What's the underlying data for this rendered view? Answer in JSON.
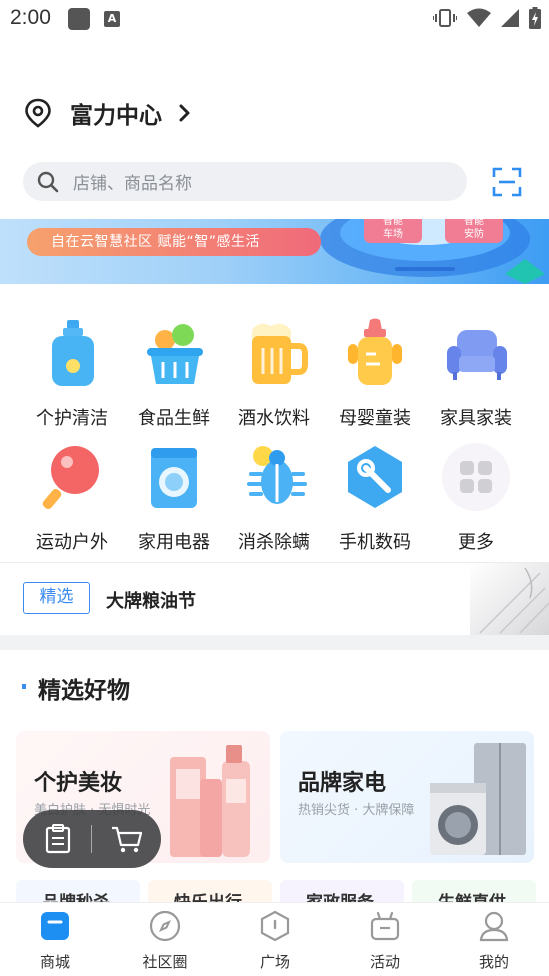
{
  "status_bar": {
    "time": "2:00"
  },
  "location": {
    "name": "富力中心"
  },
  "search": {
    "placeholder": "店铺、商品名称"
  },
  "banner": {
    "slogan": "自在云智慧社区  赋能“智”感生活",
    "chip_left": "智能\n车场",
    "chip_right": "智能\n安防"
  },
  "categories": [
    {
      "label": "个护清洁",
      "icon": "lotion-bottle-icon"
    },
    {
      "label": "食品生鲜",
      "icon": "fruit-basket-icon"
    },
    {
      "label": "酒水饮料",
      "icon": "beer-mug-icon"
    },
    {
      "label": "母婴童装",
      "icon": "baby-bottle-icon"
    },
    {
      "label": "家具家装",
      "icon": "sofa-icon"
    },
    {
      "label": "运动户外",
      "icon": "ping-pong-paddle-icon"
    },
    {
      "label": "家用电器",
      "icon": "washing-machine-icon"
    },
    {
      "label": "消杀除螨",
      "icon": "bug-icon"
    },
    {
      "label": "手机数码",
      "icon": "phone-tool-icon"
    },
    {
      "label": "更多",
      "icon": "more-grid-icon"
    }
  ],
  "featured_strip": {
    "tag": "精选",
    "text": "大牌粮油节"
  },
  "section": {
    "title": "精选好物"
  },
  "cards": [
    {
      "title": "个护美妆",
      "subtitle": "美白护肤 · 无惧时光"
    },
    {
      "title": "品牌家电",
      "subtitle": "热销尖货 · 大牌保障"
    }
  ],
  "sub_cards": [
    "品牌秒杀",
    "快乐出行",
    "家政服务",
    "生鲜直供"
  ],
  "tabs": [
    {
      "label": "商城",
      "icon": "shop-icon",
      "active": true
    },
    {
      "label": "社区圈",
      "icon": "compass-icon",
      "active": false
    },
    {
      "label": "广场",
      "icon": "square-icon",
      "active": false
    },
    {
      "label": "活动",
      "icon": "activity-bag-icon",
      "active": false
    },
    {
      "label": "我的",
      "icon": "profile-icon",
      "active": false
    }
  ],
  "colors": {
    "accent": "#3b8cf0",
    "tab_active": "#1e8ff2"
  }
}
